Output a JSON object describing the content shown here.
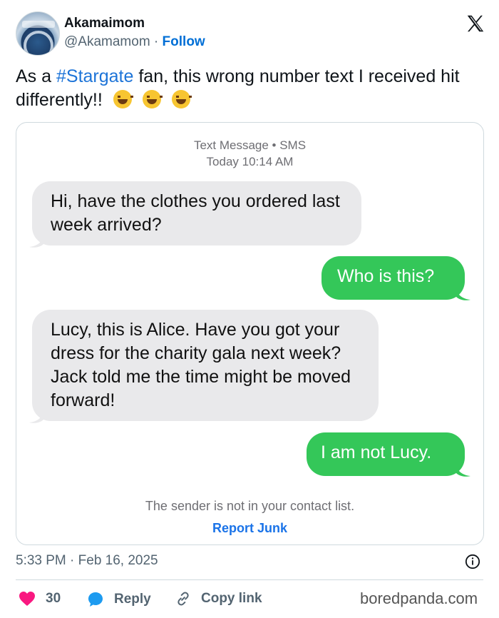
{
  "header": {
    "display_name": "Akamaimom",
    "handle": "@Akamamom",
    "separator": " · ",
    "follow_label": "Follow",
    "avatar_icon": "stargate-avatar",
    "close_icon": "x-logo-icon"
  },
  "tweet": {
    "text_before": "As a ",
    "hashtag": "#Stargate",
    "text_after": " fan, this wrong number text I received hit differently!!",
    "emojis": [
      "laughing-with-tears-emoji",
      "grinning-face-emoji",
      "laughing-with-tears-emoji"
    ]
  },
  "sms": {
    "meta_line1": "Text Message • SMS",
    "meta_line2": "Today 10:14 AM",
    "messages": [
      {
        "direction": "incoming",
        "text": "Hi, have the clothes you ordered last week arrived?"
      },
      {
        "direction": "outgoing",
        "text": "Who is this?"
      },
      {
        "direction": "incoming",
        "text": "Lucy, this is Alice. Have you got your dress for the charity gala next week? Jack told me the time might be moved forward!"
      },
      {
        "direction": "outgoing",
        "text": "I am not Lucy."
      }
    ],
    "sender_note": "The sender is not in your contact list.",
    "report_label": "Report Junk",
    "colors": {
      "incoming": "#e9e9eb",
      "outgoing": "#34c759",
      "link": "#1a73e8"
    }
  },
  "footer": {
    "timestamp": "5:33 PM · Feb 16, 2025",
    "likes": "30",
    "reply_label": "Reply",
    "copy_label": "Copy link",
    "watermark": "boredpanda.com",
    "colors": {
      "like": "#f91880",
      "reply": "#1d9bf0"
    }
  }
}
